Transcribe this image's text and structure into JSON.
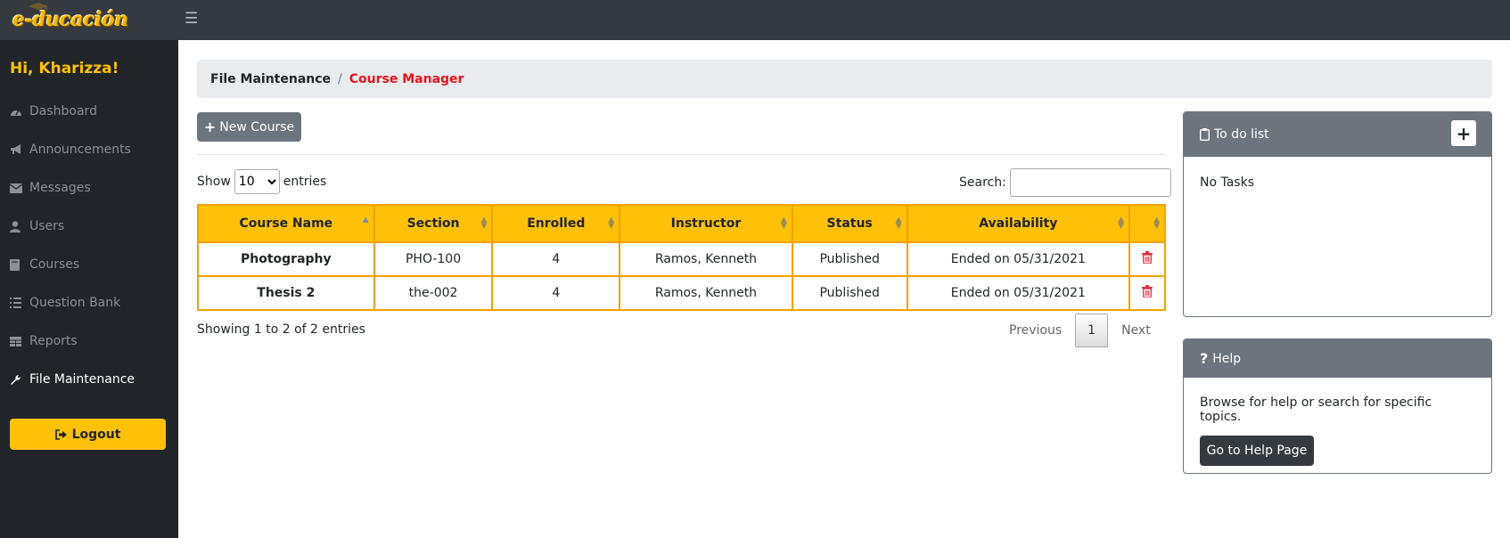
{
  "app": {
    "logo_text": "e-ducación"
  },
  "sidebar": {
    "greeting": "Hi, Kharizza!",
    "items": [
      {
        "label": "Dashboard",
        "icon": "tachometer-icon"
      },
      {
        "label": "Announcements",
        "icon": "bullhorn-icon"
      },
      {
        "label": "Messages",
        "icon": "envelope-icon"
      },
      {
        "label": "Users",
        "icon": "user-icon"
      },
      {
        "label": "Courses",
        "icon": "book-icon"
      },
      {
        "label": "Question Bank",
        "icon": "list-icon"
      },
      {
        "label": "Reports",
        "icon": "table-icon"
      },
      {
        "label": "File Maintenance",
        "icon": "wrench-icon",
        "active": true
      }
    ],
    "logout_label": "Logout"
  },
  "breadcrumb": {
    "parent": "File Maintenance",
    "current": "Course Manager"
  },
  "toolbar": {
    "new_course_label": "New Course"
  },
  "table_controls": {
    "show_label": "Show",
    "entries_label": "entries",
    "page_size": "10",
    "search_label": "Search:",
    "search_value": ""
  },
  "table": {
    "headers": [
      "Course Name",
      "Section",
      "Enrolled",
      "Instructor",
      "Status",
      "Availability"
    ],
    "rows": [
      {
        "course_name": "Photography",
        "section": "PHO-100",
        "enrolled": "4",
        "instructor": "Ramos, Kenneth",
        "status": "Published",
        "availability": "Ended on 05/31/2021"
      },
      {
        "course_name": "Thesis 2",
        "section": "the-002",
        "enrolled": "4",
        "instructor": "Ramos, Kenneth",
        "status": "Published",
        "availability": "Ended on 05/31/2021"
      }
    ]
  },
  "pagination": {
    "info": "Showing 1 to 2 of 2 entries",
    "previous": "Previous",
    "current": "1",
    "next": "Next"
  },
  "todo": {
    "title": "To do list",
    "add_label": "+",
    "empty_text": "No Tasks"
  },
  "help": {
    "title": "Help",
    "text": "Browse for help or search for specific topics.",
    "button_label": "Go to Help Page"
  },
  "colors": {
    "accent": "#ffc107",
    "danger": "#dc3545",
    "sidebar": "#212529",
    "topbar": "#343a40",
    "breadcrumb_active": "#e8141b"
  }
}
